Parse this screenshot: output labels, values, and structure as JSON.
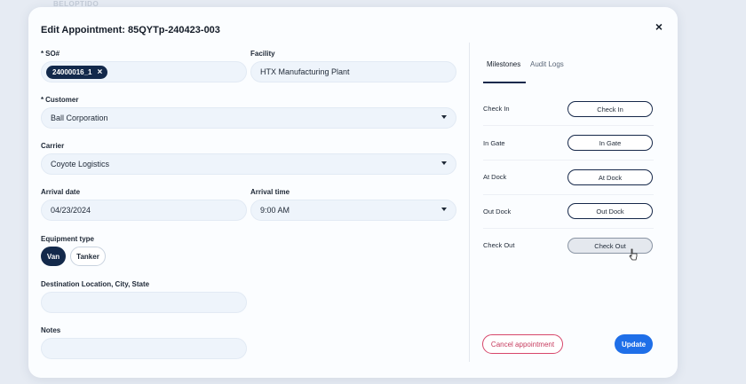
{
  "backdrop": {
    "text": "BELOPTIDO"
  },
  "modal": {
    "title": "Edit Appointment: 85QYTp-240423-003",
    "close_icon": "×"
  },
  "form": {
    "so": {
      "label": "SO#",
      "required": "*",
      "chip_value": "24000016_1",
      "chip_remove": "×"
    },
    "facility": {
      "label": "Facility",
      "value": "HTX Manufacturing Plant"
    },
    "customer": {
      "label": "Customer",
      "required": "*",
      "value": "Ball Corporation"
    },
    "carrier": {
      "label": "Carrier",
      "value": "Coyote Logistics"
    },
    "arrival_date": {
      "label": "Arrival date",
      "value": "04/23/2024"
    },
    "arrival_time": {
      "label": "Arrival time",
      "value": "9:00 AM"
    },
    "equipment_type": {
      "label": "Equipment type",
      "options": [
        "Van",
        "Tanker"
      ],
      "selected": "Van"
    },
    "destination": {
      "label": "Destination Location, City, State",
      "value": ""
    },
    "notes": {
      "label": "Notes",
      "value": ""
    }
  },
  "tabs": {
    "milestones": "Milestones",
    "audit_logs": "Audit Logs",
    "active": "Milestones"
  },
  "milestones": [
    {
      "label": "Check In",
      "button": "Check In"
    },
    {
      "label": "In Gate",
      "button": "In Gate"
    },
    {
      "label": "At Dock",
      "button": "At Dock"
    },
    {
      "label": "Out Dock",
      "button": "Out Dock"
    },
    {
      "label": "Check Out",
      "button": "Check Out"
    }
  ],
  "actions": {
    "cancel": "Cancel appointment",
    "update": "Update"
  },
  "colors": {
    "navy": "#13294b",
    "primary": "#1f6fe8",
    "danger": "#d7476b",
    "field_bg": "#eef4fb"
  }
}
